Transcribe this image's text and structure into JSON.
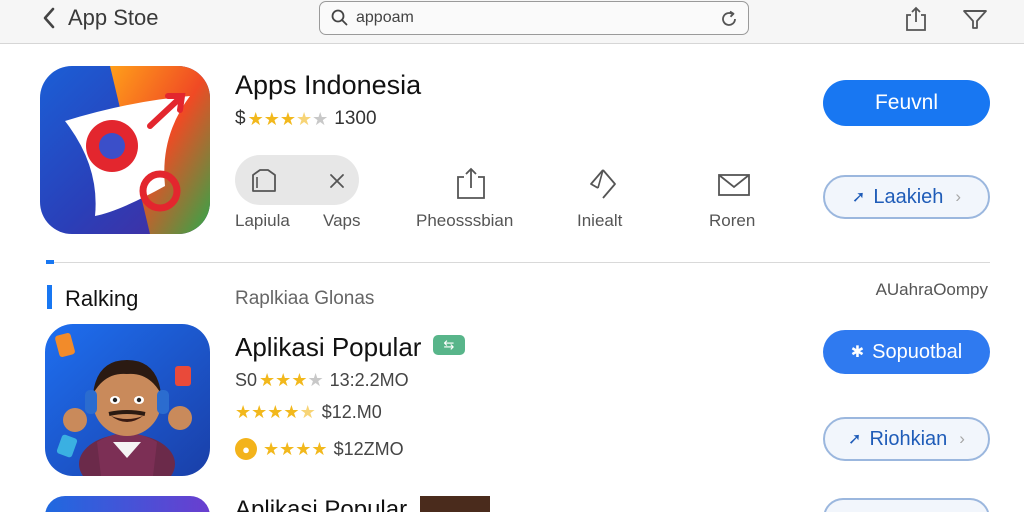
{
  "topbar": {
    "back_label": "App Stoe",
    "search_value": "",
    "search_placeholder": "appoam"
  },
  "app": {
    "title": "Apps Indonesia",
    "price_symbol": "$",
    "rating": 3.5,
    "rating_count": "1300",
    "primary_button": "Feuvnl",
    "secondary_button": "Laakieh"
  },
  "actions": [
    {
      "label": "Lapiula",
      "icon": "bookmark-tag-icon"
    },
    {
      "label": "Vaps",
      "icon": "close-icon"
    },
    {
      "label": "Pheosssbian",
      "icon": "share-icon"
    },
    {
      "label": "Iniealt",
      "icon": "pen-icon"
    },
    {
      "label": "Roren",
      "icon": "mail-icon"
    }
  ],
  "section": {
    "title": "Ralking",
    "subtitle": "Raplkiaa Glonas",
    "right_text": "AUahraOompy"
  },
  "item": {
    "title": "Aplikasi Popular",
    "badge": "⇆",
    "lines": [
      {
        "prefix": "S0",
        "rating": 3,
        "text": "13:2.2MO"
      },
      {
        "prefix": "",
        "rating": 4.5,
        "text": "$12.M0"
      },
      {
        "prefix": "coin",
        "rating": 4,
        "text": "$12ZMO"
      }
    ],
    "primary_button": "Sopuotbal",
    "secondary_button": "Riohkian"
  },
  "next_item": {
    "title": "Aplikasi Popular"
  },
  "colors": {
    "accent": "#1877f2",
    "star": "#f2b81c"
  }
}
